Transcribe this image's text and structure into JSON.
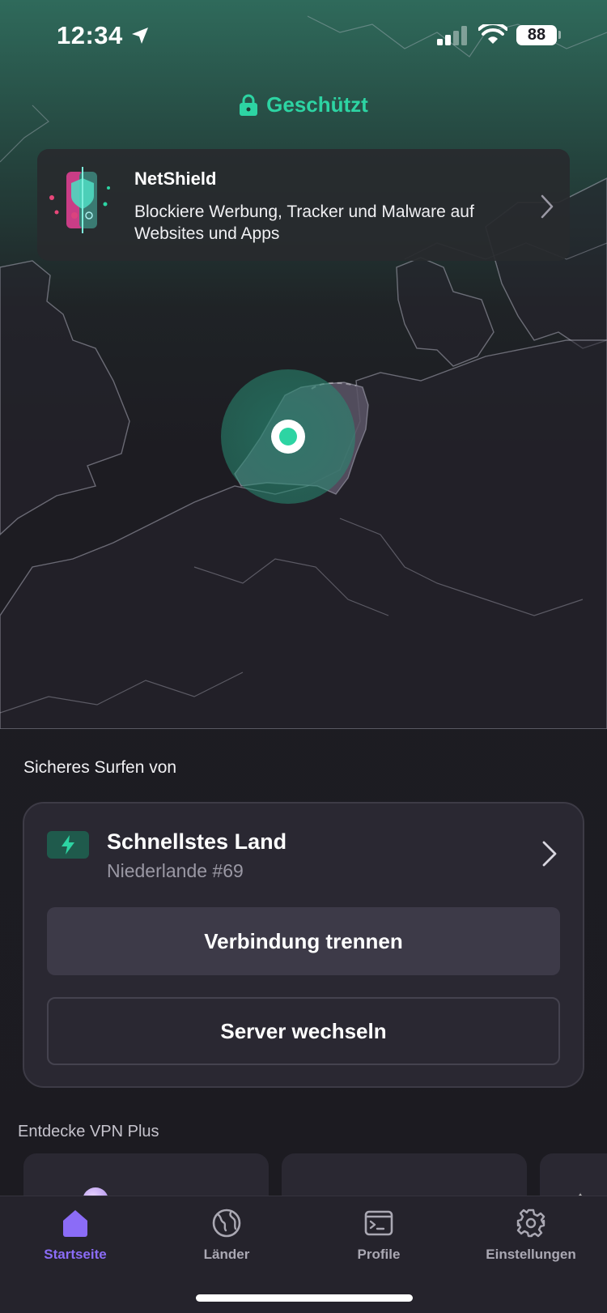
{
  "status_bar": {
    "time": "12:34",
    "battery": "88"
  },
  "protection": {
    "label": "Geschützt",
    "color": "#2dd4a3"
  },
  "netshield": {
    "title": "NetShield",
    "description": "Blockiere Werbung, Tracker und Malware auf Websites und Apps"
  },
  "connection": {
    "section_label": "Sicheres Surfen von",
    "title": "Schnellstes Land",
    "server": "Niederlande #69",
    "disconnect_label": "Verbindung trennen",
    "switch_label": "Server wechseln"
  },
  "discover": {
    "label": "Entdecke VPN Plus"
  },
  "tabs": [
    {
      "label": "Startseite",
      "icon": "home-icon",
      "active": true
    },
    {
      "label": "Länder",
      "icon": "globe-icon",
      "active": false
    },
    {
      "label": "Profile",
      "icon": "terminal-icon",
      "active": false
    },
    {
      "label": "Einstellungen",
      "icon": "gear-icon",
      "active": false
    }
  ],
  "colors": {
    "accent_green": "#2dd4a3",
    "accent_purple": "#8b6cf7",
    "background": "#1c1b22"
  }
}
